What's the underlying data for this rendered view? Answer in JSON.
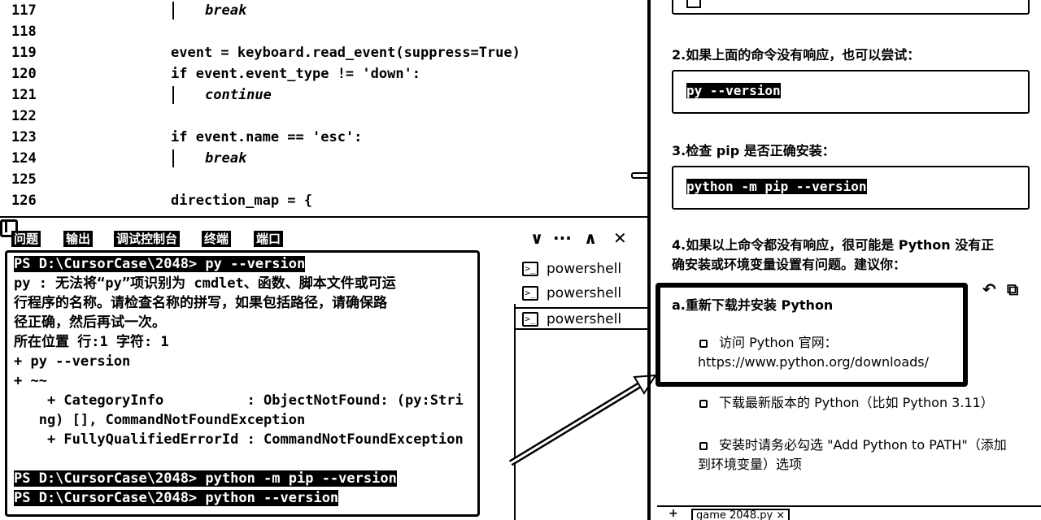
{
  "editor": {
    "lines": [
      {
        "n": "117",
        "text": "break",
        "indent": 252,
        "italic": true
      },
      {
        "n": "118",
        "text": "",
        "indent": 210,
        "italic": false
      },
      {
        "n": "119",
        "text": "event = keyboard.read_event(suppress=True)",
        "indent": 210,
        "italic": false
      },
      {
        "n": "120",
        "text": "if event.event_type != 'down':",
        "indent": 210,
        "italic": false
      },
      {
        "n": "121",
        "text": "continue",
        "indent": 252,
        "italic": true
      },
      {
        "n": "122",
        "text": "",
        "indent": 210,
        "italic": false
      },
      {
        "n": "123",
        "text": "if event.name == 'esc':",
        "indent": 210,
        "italic": false
      },
      {
        "n": "124",
        "text": "break",
        "indent": 252,
        "italic": true
      },
      {
        "n": "125",
        "text": "",
        "indent": 210,
        "italic": false
      },
      {
        "n": "126",
        "text": "direction_map = {",
        "indent": 210,
        "italic": false
      }
    ]
  },
  "panel": {
    "tabs": [
      "问题",
      "输出",
      "调试控制台",
      "终端",
      "端口"
    ],
    "icons": {
      "split": "split-terminal-icon",
      "chevron": "∨",
      "more": "···",
      "maximize": "∧",
      "close": "✕"
    }
  },
  "terminal": {
    "lines": [
      {
        "text": "PS D:\\CursorCase\\2048> py --version",
        "hl": true
      },
      {
        "text": "py : 无法将“py”项识别为 cmdlet、函数、脚本文件或可运",
        "hl": false
      },
      {
        "text": "行程序的名称。请检查名称的拼写，如果包括路径，请确保路",
        "hl": false
      },
      {
        "text": "径正确，然后再试一次。",
        "hl": false
      },
      {
        "text": "所在位置 行:1 字符: 1",
        "hl": false
      },
      {
        "text": "+ py --version",
        "hl": false
      },
      {
        "text": "+ ~~",
        "hl": false
      },
      {
        "text": "    + CategoryInfo          : ObjectNotFound: (py:Stri",
        "hl": false
      },
      {
        "text": "   ng) [], CommandNotFoundException",
        "hl": false
      },
      {
        "text": "    + FullyQualifiedErrorId : CommandNotFoundException",
        "hl": false
      },
      {
        "text": "",
        "hl": false
      },
      {
        "text": "PS D:\\CursorCase\\2048> python -m pip --version",
        "hl": true
      },
      {
        "text": "PS D:\\CursorCase\\2048> python --version",
        "hl": true
      }
    ],
    "instances": [
      "powershell",
      "powershell",
      "powershell"
    ],
    "active_instance": 2
  },
  "chat": {
    "step2": "2.如果上面的命令没有响应，也可以尝试：",
    "cmd2": "py --version",
    "step3": "3.检查 pip 是否正确安装：",
    "cmd3": "python -m pip --version",
    "step4_line1": "4.如果以上命令都没有响应，很可能是 Python 没有正",
    "step4_line2": "确安装或环境变量设置有问题。建议你：",
    "sub_a": "a.重新下载并安装 Python",
    "bullet1": "访问 Python 官网：",
    "bullet1_url": "https://www.python.org/downloads/",
    "bullet2": "下载最新版本的 Python（比如 Python 3.11）",
    "bullet3_line1": "安装时请务必勾选 \"Add Python to PATH\"（添加",
    "bullet3_line2": "到环境变量）选项",
    "bottom_plus": "+",
    "bottom_file": "game 2048.py ×"
  }
}
